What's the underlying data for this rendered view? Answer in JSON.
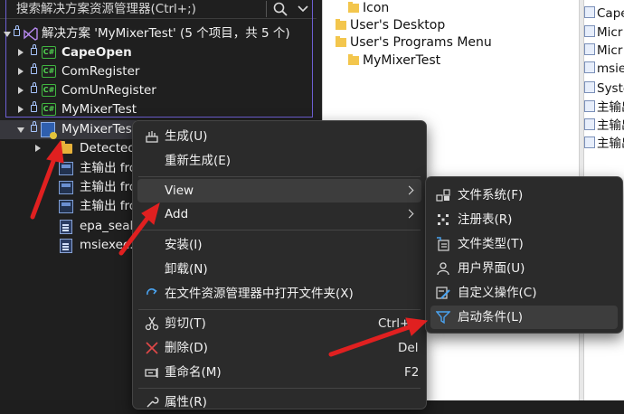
{
  "solution_explorer": {
    "search": {
      "placeholder": "搜索解决方案资源管理器(Ctrl+;)"
    },
    "solution_label": "解决方案 'MyMixerTest' (5 个项目，共 5 个)",
    "projects": [
      {
        "name": "CapeOpen",
        "bold": true
      },
      {
        "name": "ComRegister"
      },
      {
        "name": "ComUnRegister"
      },
      {
        "name": "MyMixerTest"
      }
    ],
    "setup_project": "MyMixerTest",
    "children": [
      {
        "name": "Detected"
      },
      {
        "name": "主输出 fro"
      },
      {
        "name": "主输出 fro"
      },
      {
        "name": "主输出 fro"
      },
      {
        "name": "epa_seal"
      },
      {
        "name": "msiexec."
      }
    ]
  },
  "file_system_pane": {
    "items": [
      {
        "label": "Icon",
        "indent": 2
      },
      {
        "label": "User's Desktop",
        "indent": 1
      },
      {
        "label": "User's Programs Menu",
        "indent": 1
      },
      {
        "label": "MyMixerTest",
        "indent": 2
      }
    ]
  },
  "right_pane": {
    "items": [
      "Cape",
      "Micr",
      "Micr",
      "msie",
      "Syste",
      "主输出",
      "主输出",
      "主输出"
    ]
  },
  "context_menu": {
    "items": [
      {
        "label": "生成(U)",
        "icon": "build-icon"
      },
      {
        "label": "重新生成(E)"
      },
      {
        "label": "View",
        "submenu": true
      },
      {
        "label": "Add",
        "submenu": true
      },
      {
        "label": "安装(I)"
      },
      {
        "label": "卸载(N)"
      },
      {
        "label": "在文件资源管理器中打开文件夹(X)",
        "icon": "refresh-icon"
      },
      {
        "label": "剪切(T)",
        "shortcut": "Ctrl+",
        "icon": "scissors-icon"
      },
      {
        "label": "删除(D)",
        "shortcut": "Del",
        "icon": "delete-x-icon"
      },
      {
        "label": "重命名(M)",
        "shortcut": "F2",
        "icon": "rename-icon"
      },
      {
        "label": "属性(R)",
        "icon": "wrench-icon"
      }
    ]
  },
  "view_submenu": {
    "items": [
      {
        "label": "文件系统(F)",
        "icon": "file-system-icon"
      },
      {
        "label": "注册表(R)",
        "icon": "registry-icon"
      },
      {
        "label": "文件类型(T)",
        "icon": "file-types-icon"
      },
      {
        "label": "用户界面(U)",
        "icon": "user-interface-icon"
      },
      {
        "label": "自定义操作(C)",
        "icon": "custom-actions-icon"
      },
      {
        "label": "启动条件(L)",
        "icon": "launch-conditions-icon"
      }
    ]
  },
  "colors": {
    "annotation_arrow": "#e02020",
    "selection_border": "#6d5fd3"
  }
}
